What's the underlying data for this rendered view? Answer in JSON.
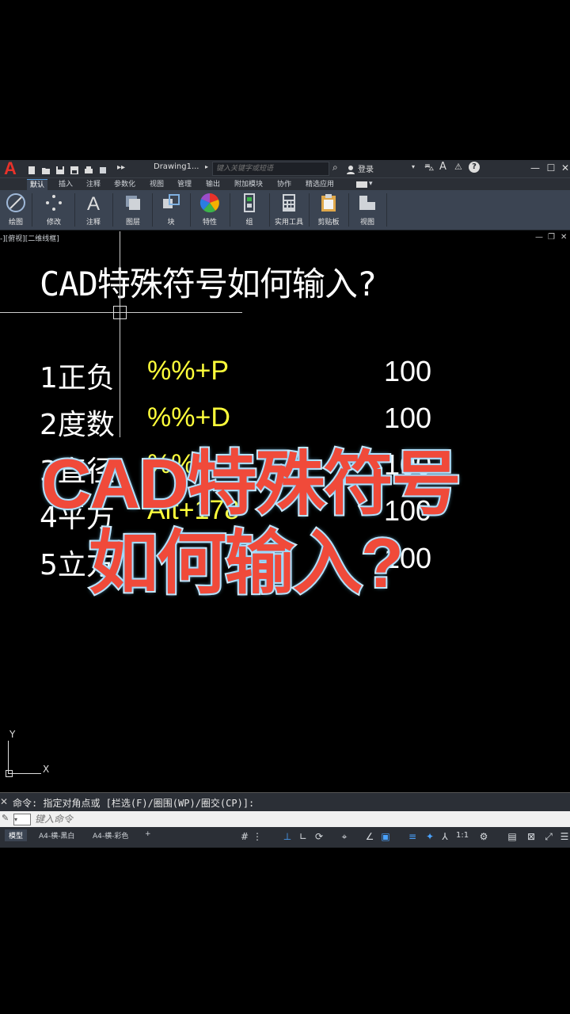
{
  "app": {
    "logo": "A",
    "doc_title": "Drawing1...",
    "search_placeholder": "键入关键字或短语",
    "login_label": "登录"
  },
  "tabs": [
    "默认",
    "插入",
    "注释",
    "参数化",
    "视图",
    "管理",
    "输出",
    "附加模块",
    "协作",
    "精选应用"
  ],
  "panels": [
    "绘图",
    "修改",
    "注释",
    "图层",
    "块",
    "特性",
    "组",
    "实用工具",
    "剪贴板",
    "视图"
  ],
  "viewport": {
    "label": "-][俯视][二维线框]"
  },
  "drawing": {
    "heading": "CAD特殊符号如何输入?",
    "rows": [
      {
        "label": "1正负",
        "code": "%%+P",
        "value": "100"
      },
      {
        "label": "2度数",
        "code": "%%+D",
        "value": "100"
      },
      {
        "label": "3直径",
        "code": "%%-",
        "value": "100"
      },
      {
        "label": "4平方",
        "code": "Alt+178",
        "value": "100"
      },
      {
        "label": "5立方",
        "code": "",
        "value": "100"
      }
    ]
  },
  "banner": {
    "line1": "CAD特殊符号",
    "line2": "如何输入?"
  },
  "ucs": {
    "x_label": "X",
    "y_label": "Y"
  },
  "command": {
    "history": "命令: 指定对角点或 [栏选(F)/圈围(WP)/圈交(CP)]:",
    "input_placeholder": "键入命令"
  },
  "layout_tabs": [
    "模型",
    "A4-横-黑白",
    "A4-横-彩色",
    "+"
  ],
  "status": {
    "scale": "1:1"
  },
  "colors": {
    "accent": "#e8322a",
    "code_yellow": "#ffff3a",
    "banner_red": "#f04a3a",
    "ribbon_bg": "#3b4452"
  }
}
